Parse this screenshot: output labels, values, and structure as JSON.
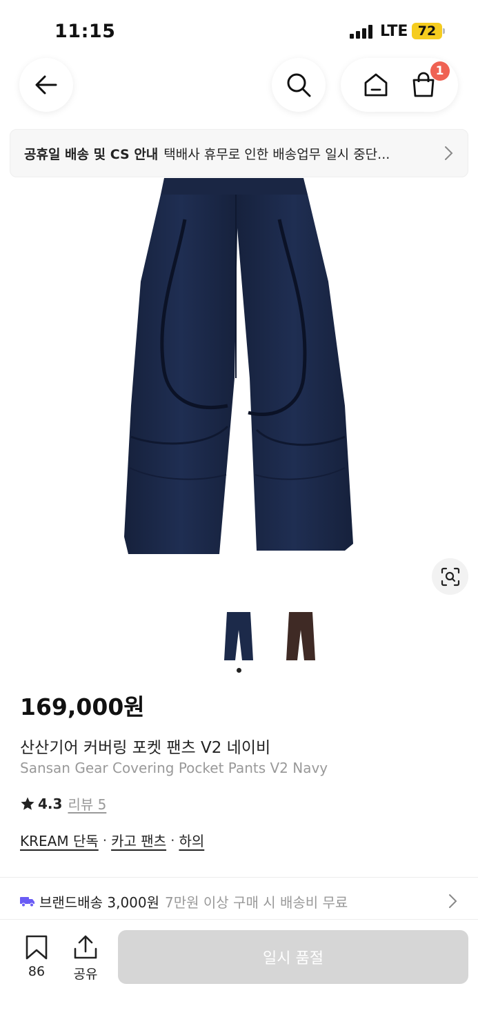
{
  "status_bar": {
    "time": "11:15",
    "network": "LTE",
    "battery": "72"
  },
  "nav": {
    "back_icon": "arrow-left-icon",
    "search_icon": "search-icon",
    "home_icon": "home-icon",
    "cart_icon": "shopping-bag-icon",
    "cart_badge": "1"
  },
  "notice": {
    "title": "공휴일 배송 및 CS 안내",
    "text": "택배사 휴무로 인한 배송업무 일시 중단..."
  },
  "product": {
    "image_icon": "navy-pants-image",
    "lens_icon": "image-search-icon",
    "thumbnails": [
      "navy",
      "brown"
    ],
    "selected_thumbnail": 0,
    "price": "169,000원",
    "name_ko": "산산기어 커버링 포켓 팬츠 V2 네이비",
    "name_en": "Sansan Gear Covering Pocket Pants V2 Navy",
    "rating": "4.3",
    "review_link": "리뷰 5",
    "tags": [
      "KREAM 단독",
      "카고 팬츠",
      "하의"
    ],
    "tag_separator": "·"
  },
  "shipping": {
    "icon": "truck-icon",
    "title": "브랜드배송 3,000원",
    "note": "7만원 이상 구매 시 배송비 무료"
  },
  "bottom_bar": {
    "bookmark_count": "86",
    "share_label": "공유",
    "buy_label": "일시 품절"
  },
  "colors": {
    "navy": "#1c2a4a",
    "brown": "#3f2a25",
    "badge": "#ef6253",
    "battery": "#f5cc1f",
    "disabled_button": "#d6d6d6",
    "truck": "#6a5cf5"
  }
}
